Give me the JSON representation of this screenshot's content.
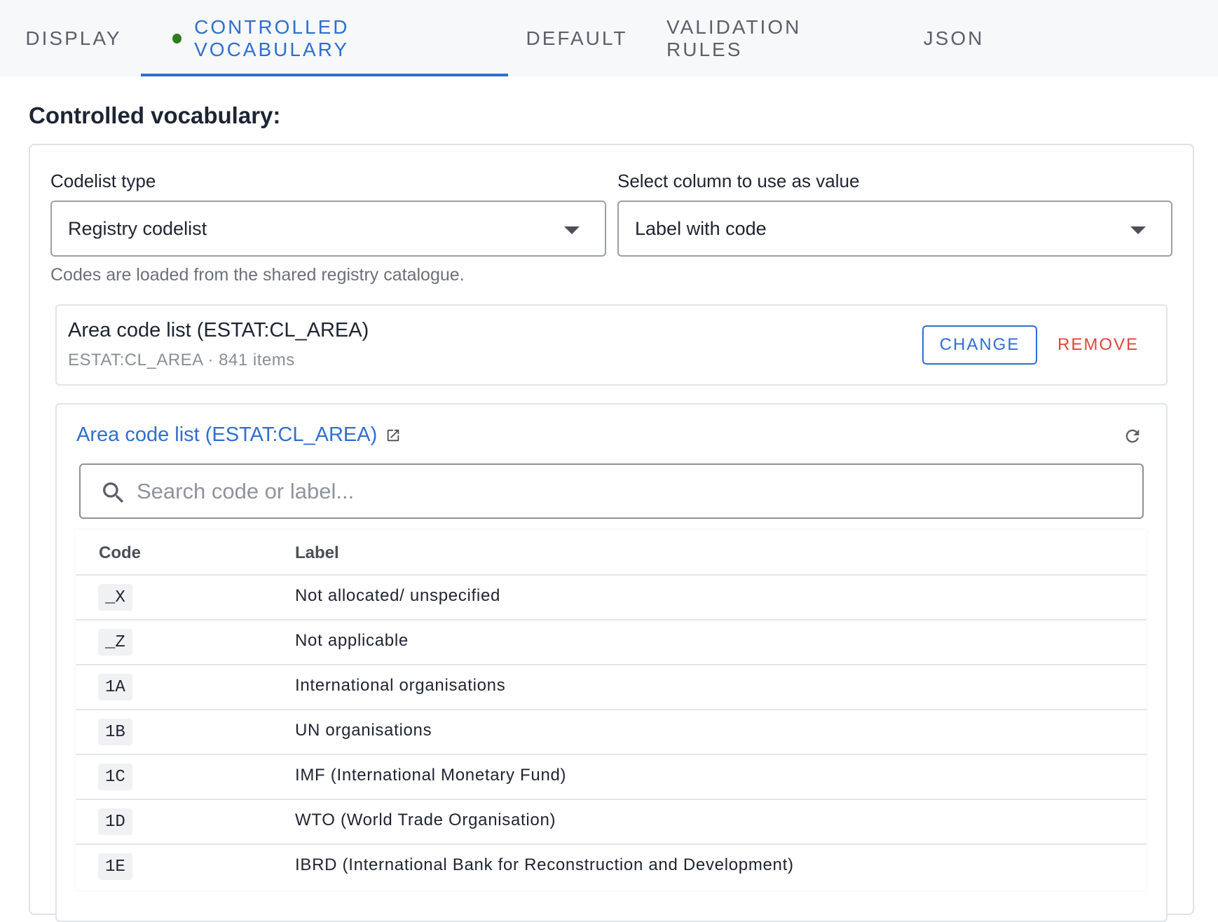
{
  "tabs": [
    {
      "label": "DISPLAY",
      "active": false
    },
    {
      "label": "CONTROLLED VOCABULARY",
      "active": true,
      "status_color": "#2e7d1f"
    },
    {
      "label": "DEFAULT",
      "active": false
    },
    {
      "label": "VALIDATION RULES",
      "active": false
    },
    {
      "label": "JSON",
      "active": false
    }
  ],
  "accent_color": "#2f6fd0",
  "danger_color": "#e0473a",
  "section": {
    "title": "Controlled vocabulary:"
  },
  "codelist_type": {
    "label": "Codelist type",
    "value": "Registry codelist"
  },
  "value_column": {
    "label": "Select column to use as value",
    "value": "Label with code"
  },
  "helper_text": "Codes are loaded from the shared registry catalogue.",
  "selected_codelist": {
    "title": "Area code list (ESTAT:CL_AREA)",
    "subtitle": "ESTAT:CL_AREA · 841 items",
    "change_label": "CHANGE",
    "remove_label": "REMOVE"
  },
  "preview": {
    "link_label": "Area code list (ESTAT:CL_AREA)",
    "link_icon": "external-link-icon",
    "refresh_icon": "refresh-icon",
    "search_placeholder": "Search code or label...",
    "search_icon": "search-icon",
    "columns": {
      "code": "Code",
      "label": "Label"
    },
    "rows": [
      {
        "code": "_X",
        "label": "Not allocated/ unspecified"
      },
      {
        "code": "_Z",
        "label": "Not applicable"
      },
      {
        "code": "1A",
        "label": "International organisations"
      },
      {
        "code": "1B",
        "label": "UN organisations"
      },
      {
        "code": "1C",
        "label": "IMF (International Monetary Fund)"
      },
      {
        "code": "1D",
        "label": "WTO (World Trade Organisation)"
      },
      {
        "code": "1E",
        "label": "IBRD (International Bank for Reconstruction and Development)"
      }
    ]
  }
}
